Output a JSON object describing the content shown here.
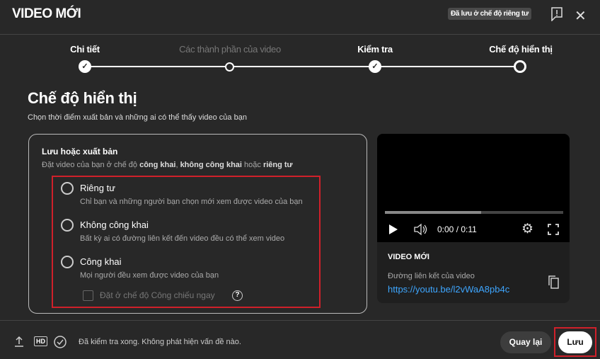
{
  "header": {
    "title": "VIDEO MỚI",
    "saved_badge": "Đã lưu ở chế độ riêng tư"
  },
  "steps": [
    {
      "label": "Chi tiết",
      "state": "done"
    },
    {
      "label": "Các thành phần của video",
      "state": "skipped"
    },
    {
      "label": "Kiểm tra",
      "state": "done"
    },
    {
      "label": "Chế độ hiển thị",
      "state": "current"
    }
  ],
  "main": {
    "title": "Chế độ hiển thị",
    "subtitle": "Chọn thời điểm xuất bản và những ai có thể thấy video của bạn"
  },
  "card": {
    "title": "Lưu hoặc xuất bản",
    "desc_prefix": "Đặt video của bạn ở chế độ ",
    "public": "công khai",
    "sep": ", ",
    "unlisted": "không công khai",
    "or": " hoặc ",
    "private": "riêng tư",
    "options": [
      {
        "label": "Riêng tư",
        "desc": "Chỉ bạn và những người bạn chọn mới xem được video của bạn"
      },
      {
        "label": "Không công khai",
        "desc": "Bất kỳ ai có đường liên kết đến video đều có thể xem video"
      },
      {
        "label": "Công khai",
        "desc": "Mọi người đều xem được video của bạn"
      }
    ],
    "premiere": "Đặt ở chế độ Công chiếu ngay",
    "help": "?"
  },
  "video": {
    "time": "0:00 / 0:11",
    "progress": 0.54,
    "title": "VIDEO MỚI",
    "link_label": "Đường liên kết của video",
    "link": "https://youtu.be/l2vWaA8pb4c"
  },
  "footer": {
    "hd": "HD",
    "status": "Đã kiểm tra xong. Không phát hiện vấn đề nào.",
    "back": "Quay lại",
    "save": "Lưu"
  }
}
